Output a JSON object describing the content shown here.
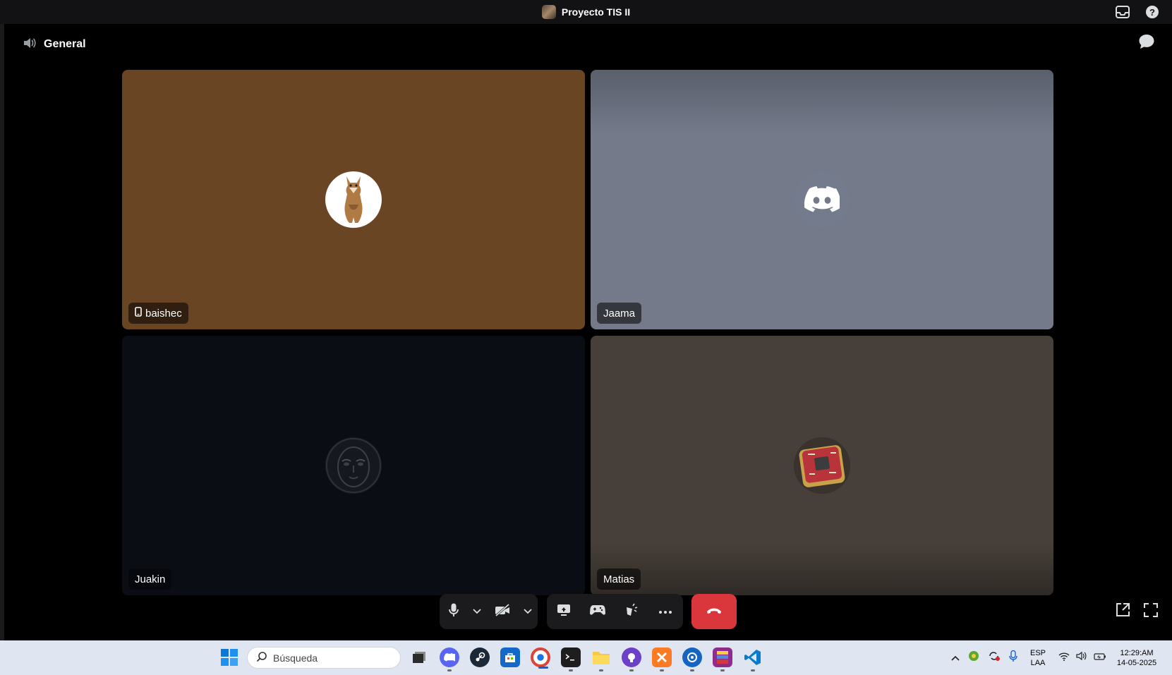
{
  "window": {
    "title": "Proyecto TIS II"
  },
  "channel": {
    "name": "General"
  },
  "participants": [
    {
      "name": "baishec",
      "device": "mobile",
      "avatar": "fox-avatar",
      "bg": "#6a4524"
    },
    {
      "name": "Jaama",
      "avatar": "discord-default-avatar",
      "bg": "#75798a"
    },
    {
      "name": "Juakin",
      "avatar": "mask-avatar",
      "bg": "#0b0d14"
    },
    {
      "name": "Matias",
      "avatar": "chip-avatar",
      "bg": "#473f39"
    }
  ],
  "controls": {
    "buttons": [
      "microphone",
      "microphone-options",
      "camera-off",
      "camera-options",
      "screen-share",
      "activities",
      "soundboard",
      "more",
      "disconnect",
      "pop-out",
      "fullscreen"
    ],
    "hangup_color": "#da373c"
  },
  "taskbar": {
    "search_placeholder": "Búsqueda",
    "apps": [
      "task-view",
      "discord",
      "steam",
      "microsoft-store",
      "chrome",
      "terminal",
      "file-explorer",
      "github-desktop",
      "xampp",
      "app-blue",
      "winrar",
      "vscode"
    ],
    "language": "ESP",
    "layout": "LAA",
    "time": "12:29:AM",
    "date": "14-05-2025"
  },
  "colors": {
    "accent": "#5865f2",
    "background": "#000000",
    "titlebar": "#121214"
  }
}
